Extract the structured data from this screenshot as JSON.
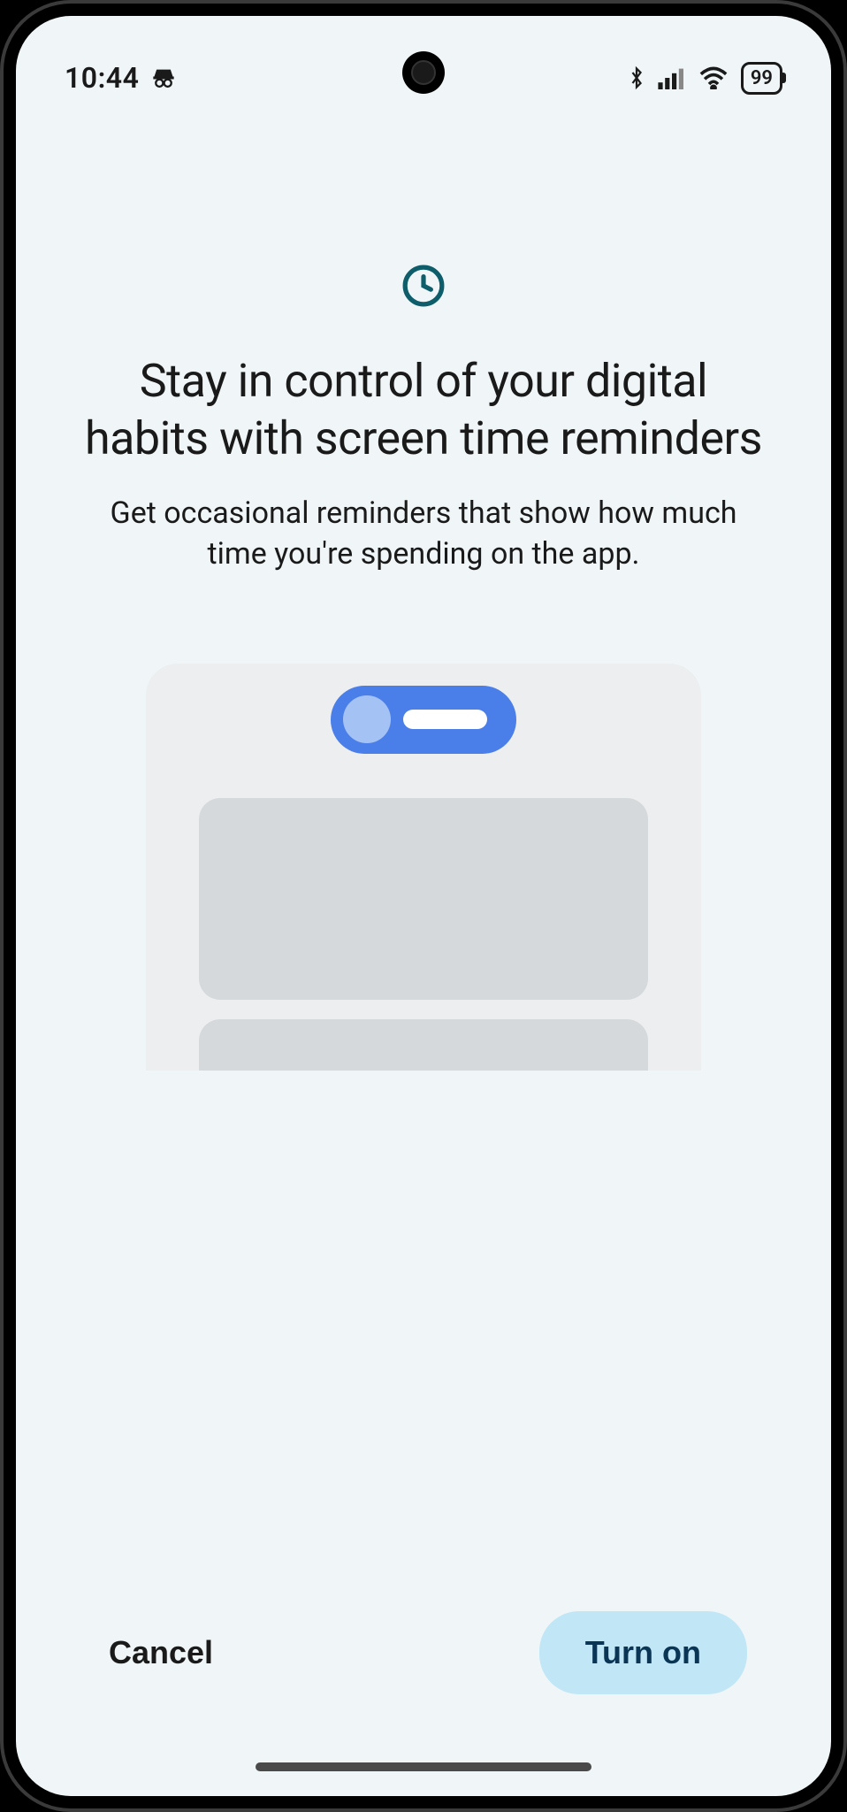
{
  "status_bar": {
    "time": "10:44",
    "battery_level": "99"
  },
  "dialog": {
    "title": "Stay in control of your digital habits with screen time reminders",
    "subtitle": "Get occasional reminders that show how much time you're spending on the app."
  },
  "buttons": {
    "cancel_label": "Cancel",
    "confirm_label": "Turn on"
  },
  "colors": {
    "background": "#f0f6f8",
    "accent": "#4a7ee8",
    "confirm_button": "#c1e7f7",
    "text_primary": "#1a1a1a",
    "clock_icon": "#0e5d6b"
  }
}
